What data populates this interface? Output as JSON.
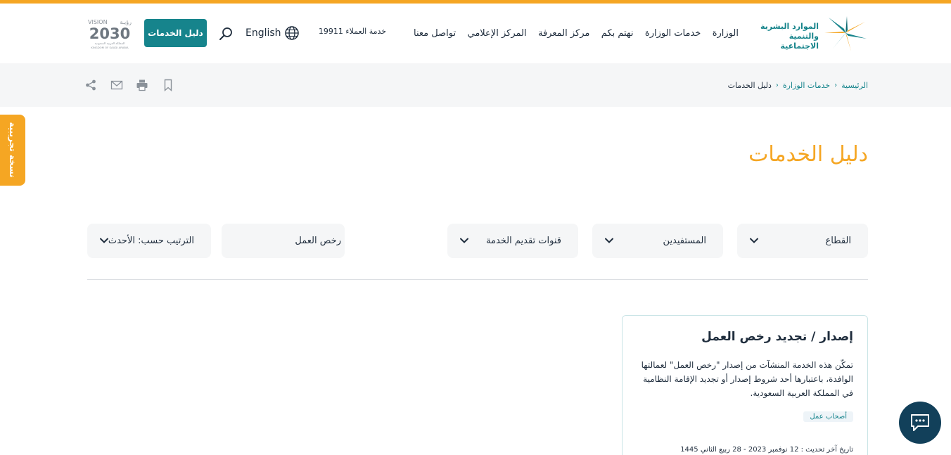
{
  "header": {
    "logo": {
      "line1": "الموارد البشرية",
      "line2": "والتنمية الاجتماعية"
    },
    "nav": [
      {
        "label": "الوزارة"
      },
      {
        "label": "خدمات الوزارة"
      },
      {
        "label": "نهتم بكم"
      },
      {
        "label": "مركز المعرفة"
      },
      {
        "label": "المركز الإعلامي"
      },
      {
        "label": "تواصل معنا"
      }
    ],
    "hotline": "خدمة العملاء 19911",
    "language": "English",
    "guide_button": "دليل الخدمات",
    "vision": {
      "top": "VISION",
      "arabic": "رؤيـة",
      "year": "2030",
      "sub1": "المملكة العربية السعودية",
      "sub2": "KINGDOM OF SAUDI ARABIA"
    }
  },
  "breadcrumb": {
    "home": "الرئيسية",
    "services": "خدمات الوزارة",
    "current": "دليل الخدمات"
  },
  "trial_tab": "نسخة تجريبية",
  "page_title": "دليل الخدمات",
  "filters": {
    "sector": "القطاع",
    "beneficiaries": "المستفيدين",
    "channels": "قنوات تقديم الخدمة",
    "search_value": "رخص العمل",
    "sort": "الترتيب حسب: الأحدث"
  },
  "card": {
    "title": "إصدار / تجديد رخص العمل",
    "description": "تمكّن هذه الخدمة المنشآت من إصدار \"رخص العمل\" لعمالتها الوافدة، باعتبارها أحد شروط إصدار أو تجديد الإقامة النظامية في المملكة العربية السعودية.",
    "tag": "أصحاب عمل",
    "date": "تاريخ آخر تحديث : 12 نوفمبر 2023 - 28 ربيع الثاني 1445"
  },
  "colors": {
    "accent": "#f5a623",
    "brand": "#16848c",
    "chat": "#12405a"
  }
}
